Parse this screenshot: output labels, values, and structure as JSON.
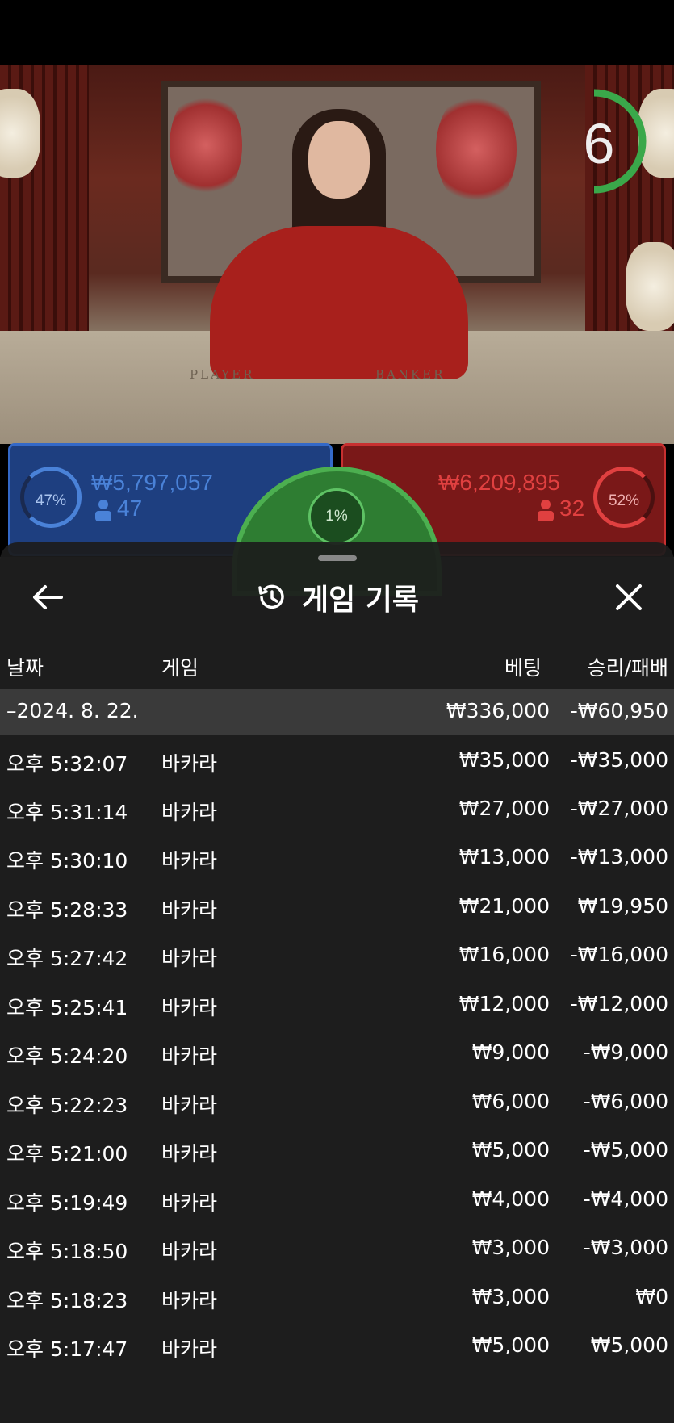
{
  "timer": {
    "value": "6"
  },
  "table_labels": {
    "player": "PLAYER",
    "banker": "BANKER"
  },
  "bets": {
    "player": {
      "percent": "47%",
      "amount": "₩5,797,057",
      "players": "47",
      "color": "#4a82d8"
    },
    "tie": {
      "percent": "1%"
    },
    "banker": {
      "percent": "52%",
      "amount": "₩6,209,895",
      "players": "32",
      "color": "#e04040"
    }
  },
  "sheet": {
    "title": "게임 기록",
    "back_icon": "arrow-left-icon",
    "history_icon": "history-icon",
    "close_icon": "close-icon",
    "columns": {
      "date": "날짜",
      "game": "게임",
      "bet": "베팅",
      "result": "승리/패배"
    },
    "summary": {
      "date": "–2024. 8. 22.",
      "bet": "₩336,000",
      "result": "-₩60,950"
    },
    "rows": [
      {
        "time": "오후 5:32:07",
        "game": "바카라",
        "bet": "₩35,000",
        "result": "-₩35,000"
      },
      {
        "time": "오후 5:31:14",
        "game": "바카라",
        "bet": "₩27,000",
        "result": "-₩27,000"
      },
      {
        "time": "오후 5:30:10",
        "game": "바카라",
        "bet": "₩13,000",
        "result": "-₩13,000"
      },
      {
        "time": "오후 5:28:33",
        "game": "바카라",
        "bet": "₩21,000",
        "result": "₩19,950"
      },
      {
        "time": "오후 5:27:42",
        "game": "바카라",
        "bet": "₩16,000",
        "result": "-₩16,000"
      },
      {
        "time": "오후 5:25:41",
        "game": "바카라",
        "bet": "₩12,000",
        "result": "-₩12,000"
      },
      {
        "time": "오후 5:24:20",
        "game": "바카라",
        "bet": "₩9,000",
        "result": "-₩9,000"
      },
      {
        "time": "오후 5:22:23",
        "game": "바카라",
        "bet": "₩6,000",
        "result": "-₩6,000"
      },
      {
        "time": "오후 5:21:00",
        "game": "바카라",
        "bet": "₩5,000",
        "result": "-₩5,000"
      },
      {
        "time": "오후 5:19:49",
        "game": "바카라",
        "bet": "₩4,000",
        "result": "-₩4,000"
      },
      {
        "time": "오후 5:18:50",
        "game": "바카라",
        "bet": "₩3,000",
        "result": "-₩3,000"
      },
      {
        "time": "오후 5:18:23",
        "game": "바카라",
        "bet": "₩3,000",
        "result": "₩0"
      },
      {
        "time": "오후 5:17:47",
        "game": "바카라",
        "bet": "₩5,000",
        "result": "₩5,000"
      }
    ]
  }
}
